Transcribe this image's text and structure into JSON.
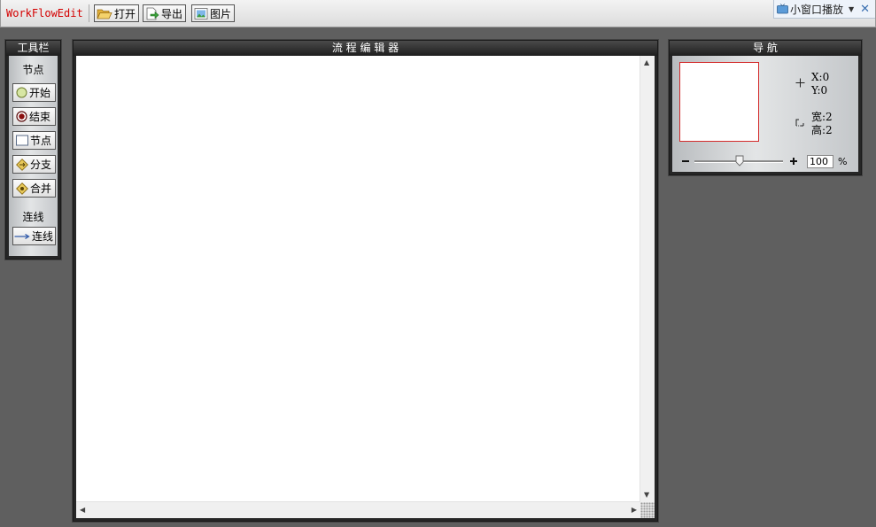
{
  "app": {
    "title": "WorkFlowEdit"
  },
  "toolbar": {
    "open_label": "打开",
    "export_label": "导出",
    "image_label": "图片"
  },
  "mini_play": {
    "label": "小窗口播放"
  },
  "toolbox": {
    "title": "工具栏",
    "nodes_section": "节点",
    "items": [
      {
        "label": "开始",
        "icon": "start-circle-icon"
      },
      {
        "label": "结束",
        "icon": "end-circle-icon"
      },
      {
        "label": "节点",
        "icon": "node-square-icon"
      },
      {
        "label": "分支",
        "icon": "branch-diamond-icon"
      },
      {
        "label": "合并",
        "icon": "merge-diamond-icon"
      }
    ],
    "lines_section": "连线",
    "line_item": {
      "label": "连线",
      "icon": "arrow-line-icon"
    }
  },
  "editor": {
    "title": "流 程 编 辑 器"
  },
  "navigation": {
    "title": "导 航",
    "x": "X:0",
    "y": "Y:0",
    "width": "宽:2",
    "height": "高:2",
    "zoom_value": "100",
    "zoom_unit": "%",
    "zoom_level": 0.5
  },
  "colors": {
    "accent_red": "#d40000",
    "panel_dark": "#262626",
    "background": "#5f5f5f"
  }
}
